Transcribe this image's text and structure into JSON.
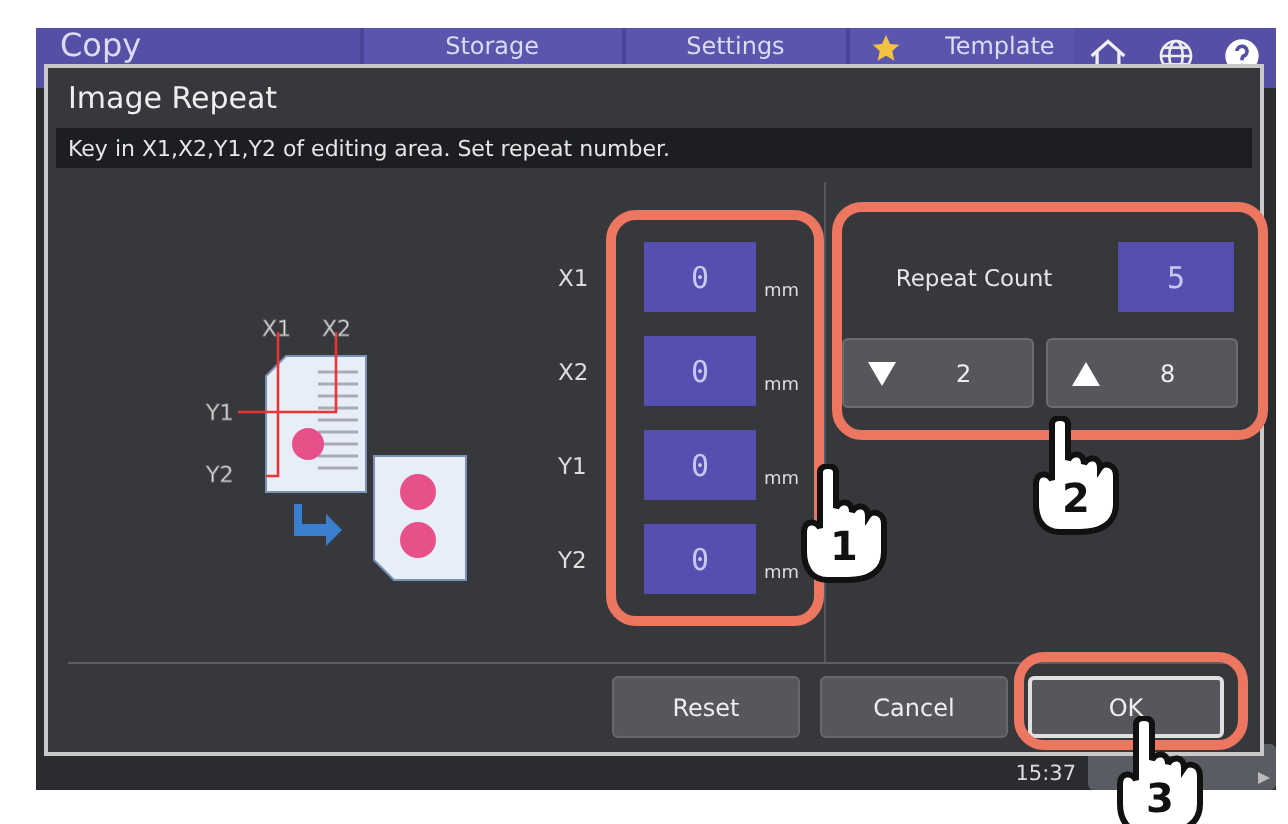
{
  "top_bar": {
    "title": "Copy",
    "tabs": [
      {
        "label": "Storage",
        "kind": "plain"
      },
      {
        "label": "Settings",
        "kind": "plain"
      },
      {
        "label": "Template",
        "kind": "star"
      }
    ]
  },
  "dialog": {
    "title": "Image Repeat",
    "instruction": "Key in X1,X2,Y1,Y2 of editing area. Set repeat number.",
    "illustration": {
      "labels": [
        "X1",
        "X2",
        "Y1",
        "Y2"
      ]
    },
    "fields": [
      {
        "label": "X1",
        "value": "0",
        "unit": "mm"
      },
      {
        "label": "X2",
        "value": "0",
        "unit": "mm"
      },
      {
        "label": "Y1",
        "value": "0",
        "unit": "mm"
      },
      {
        "label": "Y2",
        "value": "0",
        "unit": "mm"
      }
    ],
    "repeat": {
      "label": "Repeat Count",
      "value": "5",
      "down": "2",
      "up": "8"
    },
    "buttons": [
      {
        "label": "Reset",
        "selected": false
      },
      {
        "label": "Cancel",
        "selected": false
      },
      {
        "label": "OK",
        "selected": true
      }
    ]
  },
  "status": {
    "time": "15:37"
  },
  "callouts": [
    {
      "number": "1"
    },
    {
      "number": "2"
    },
    {
      "number": "3"
    }
  ]
}
